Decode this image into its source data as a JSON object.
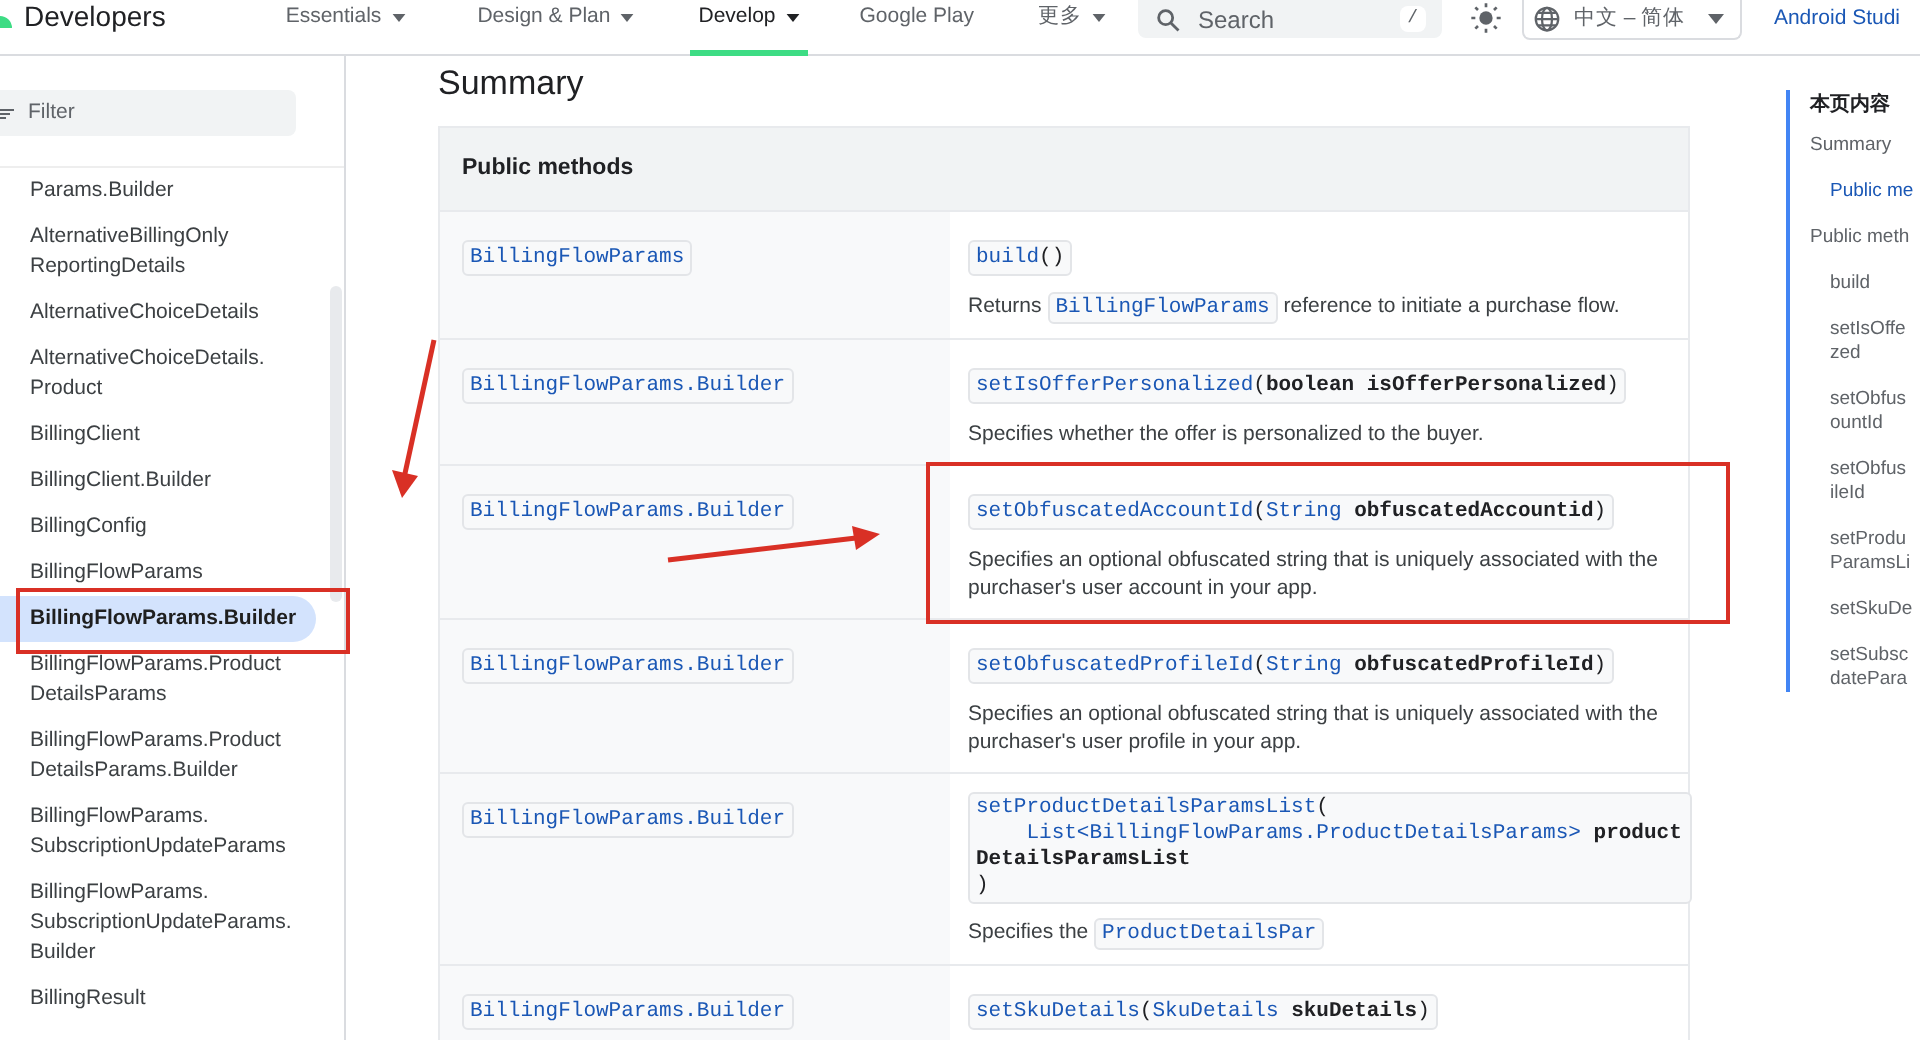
{
  "header": {
    "logo": "Developers",
    "nav": [
      {
        "label": "Essentials",
        "dropdown": true,
        "selected": false
      },
      {
        "label": "Design & Plan",
        "dropdown": true,
        "selected": false
      },
      {
        "label": "Develop",
        "dropdown": true,
        "selected": true
      },
      {
        "label": "Google Play",
        "dropdown": false,
        "selected": false
      },
      {
        "label": "更多",
        "dropdown": true,
        "selected": false
      }
    ],
    "search": {
      "placeholder": "Search",
      "shortcut": "/"
    },
    "language": "中文 – 简体",
    "link": "Android Studi"
  },
  "sidebar": {
    "filter": {
      "placeholder": "Filter"
    },
    "items": [
      {
        "lines": [
          "Params.Builder"
        ],
        "selected": false
      },
      {
        "lines": [
          "AlternativeBillingOnly",
          "ReportingDetails"
        ],
        "selected": false
      },
      {
        "lines": [
          "AlternativeChoiceDetails"
        ],
        "selected": false
      },
      {
        "lines": [
          "AlternativeChoiceDetails.",
          "Product"
        ],
        "selected": false
      },
      {
        "lines": [
          "BillingClient"
        ],
        "selected": false
      },
      {
        "lines": [
          "BillingClient.Builder"
        ],
        "selected": false
      },
      {
        "lines": [
          "BillingConfig"
        ],
        "selected": false
      },
      {
        "lines": [
          "BillingFlowParams"
        ],
        "selected": false
      },
      {
        "lines": [
          "BillingFlowParams.Builder"
        ],
        "selected": true
      },
      {
        "lines": [
          "BillingFlowParams.Product",
          "DetailsParams"
        ],
        "selected": false
      },
      {
        "lines": [
          "BillingFlowParams.Product",
          "DetailsParams.Builder"
        ],
        "selected": false
      },
      {
        "lines": [
          "BillingFlowParams.",
          "SubscriptionUpdateParams"
        ],
        "selected": false
      },
      {
        "lines": [
          "BillingFlowParams.",
          "SubscriptionUpdateParams.",
          "Builder"
        ],
        "selected": false
      },
      {
        "lines": [
          "BillingResult"
        ],
        "selected": false
      }
    ]
  },
  "main": {
    "heading": "Summary",
    "table": {
      "title": "Public methods",
      "rows": [
        {
          "return_type": "BillingFlowParams",
          "signature": [
            {
              "kind": "method",
              "text": "build"
            },
            {
              "kind": "punct",
              "text": "()"
            }
          ],
          "description": [
            {
              "kind": "text",
              "text": "Returns "
            },
            {
              "kind": "code",
              "text": "BillingFlowParams"
            },
            {
              "kind": "text",
              "text": " reference to initiate a purchase flow."
            }
          ]
        },
        {
          "return_type": "BillingFlowParams.Builder",
          "signature": [
            {
              "kind": "method",
              "text": "setIsOfferPersonalized"
            },
            {
              "kind": "punct",
              "text": "("
            },
            {
              "kind": "keyword",
              "text": "boolean"
            },
            {
              "kind": "param",
              "text": "isOfferPersonalized"
            },
            {
              "kind": "punct",
              "text": ")"
            }
          ],
          "description": [
            {
              "kind": "text",
              "text": "Specifies whether the offer is personalized to the buyer."
            }
          ]
        },
        {
          "return_type": "BillingFlowParams.Builder",
          "signature": [
            {
              "kind": "method",
              "text": "setObfuscatedAccountId"
            },
            {
              "kind": "punct",
              "text": "("
            },
            {
              "kind": "type",
              "text": "String"
            },
            {
              "kind": "param",
              "text": "obfuscatedAccountid"
            },
            {
              "kind": "punct",
              "text": ")"
            }
          ],
          "description": [
            {
              "kind": "text",
              "text": "Specifies an optional obfuscated string that is uniquely associated with the purchaser's user account in your app."
            }
          ]
        },
        {
          "return_type": "BillingFlowParams.Builder",
          "signature": [
            {
              "kind": "method",
              "text": "setObfuscatedProfileId"
            },
            {
              "kind": "punct",
              "text": "("
            },
            {
              "kind": "type",
              "text": "String"
            },
            {
              "kind": "param",
              "text": "obfuscatedProfileId"
            },
            {
              "kind": "punct",
              "text": ")"
            }
          ],
          "description": [
            {
              "kind": "text",
              "text": "Specifies an optional obfuscated string that is uniquely associated with the purchaser's user profile in your app."
            }
          ]
        },
        {
          "return_type": "BillingFlowParams.Builder",
          "multiline": true,
          "signature": [
            {
              "kind": "method",
              "text": "setProductDetailsParamsList"
            },
            {
              "kind": "punct",
              "text": "("
            },
            {
              "kind": "type",
              "text": "List<BillingFlowParams.ProductDetailsParams>"
            },
            {
              "kind": "param",
              "text": "productDetailsParamsList"
            },
            {
              "kind": "punct",
              "text": ")"
            }
          ],
          "description": [
            {
              "kind": "text",
              "text": "Specifies the "
            },
            {
              "kind": "code",
              "text": "ProductDetailsPar"
            }
          ]
        },
        {
          "return_type": "BillingFlowParams.Builder",
          "signature": [
            {
              "kind": "method",
              "text": "setSkuDetails"
            },
            {
              "kind": "punct",
              "text": "("
            },
            {
              "kind": "type",
              "text": "SkuDetails"
            },
            {
              "kind": "param",
              "text": "skuDetails"
            },
            {
              "kind": "punct",
              "text": ")"
            }
          ]
        }
      ]
    }
  },
  "toc": {
    "title": "本页内容",
    "items": [
      {
        "lines": [
          "Summary"
        ],
        "selected": false,
        "indented": false
      },
      {
        "lines": [
          "Public me"
        ],
        "selected": true,
        "indented": true
      },
      {
        "lines": [
          "Public meth"
        ],
        "selected": false,
        "indented": false
      },
      {
        "lines": [
          "build"
        ],
        "selected": false,
        "indented": true
      },
      {
        "lines": [
          "setIsOffe",
          "zed"
        ],
        "selected": false,
        "indented": true
      },
      {
        "lines": [
          "setObfus",
          "ountId"
        ],
        "selected": false,
        "indented": true
      },
      {
        "lines": [
          "setObfus",
          "ileId"
        ],
        "selected": false,
        "indented": true
      },
      {
        "lines": [
          "setProdu",
          "ParamsLi"
        ],
        "selected": false,
        "indented": true
      },
      {
        "lines": [
          "setSkuDe"
        ],
        "selected": false,
        "indented": true
      },
      {
        "lines": [
          "setSubsc",
          "datePara"
        ],
        "selected": false,
        "indented": true
      }
    ]
  }
}
